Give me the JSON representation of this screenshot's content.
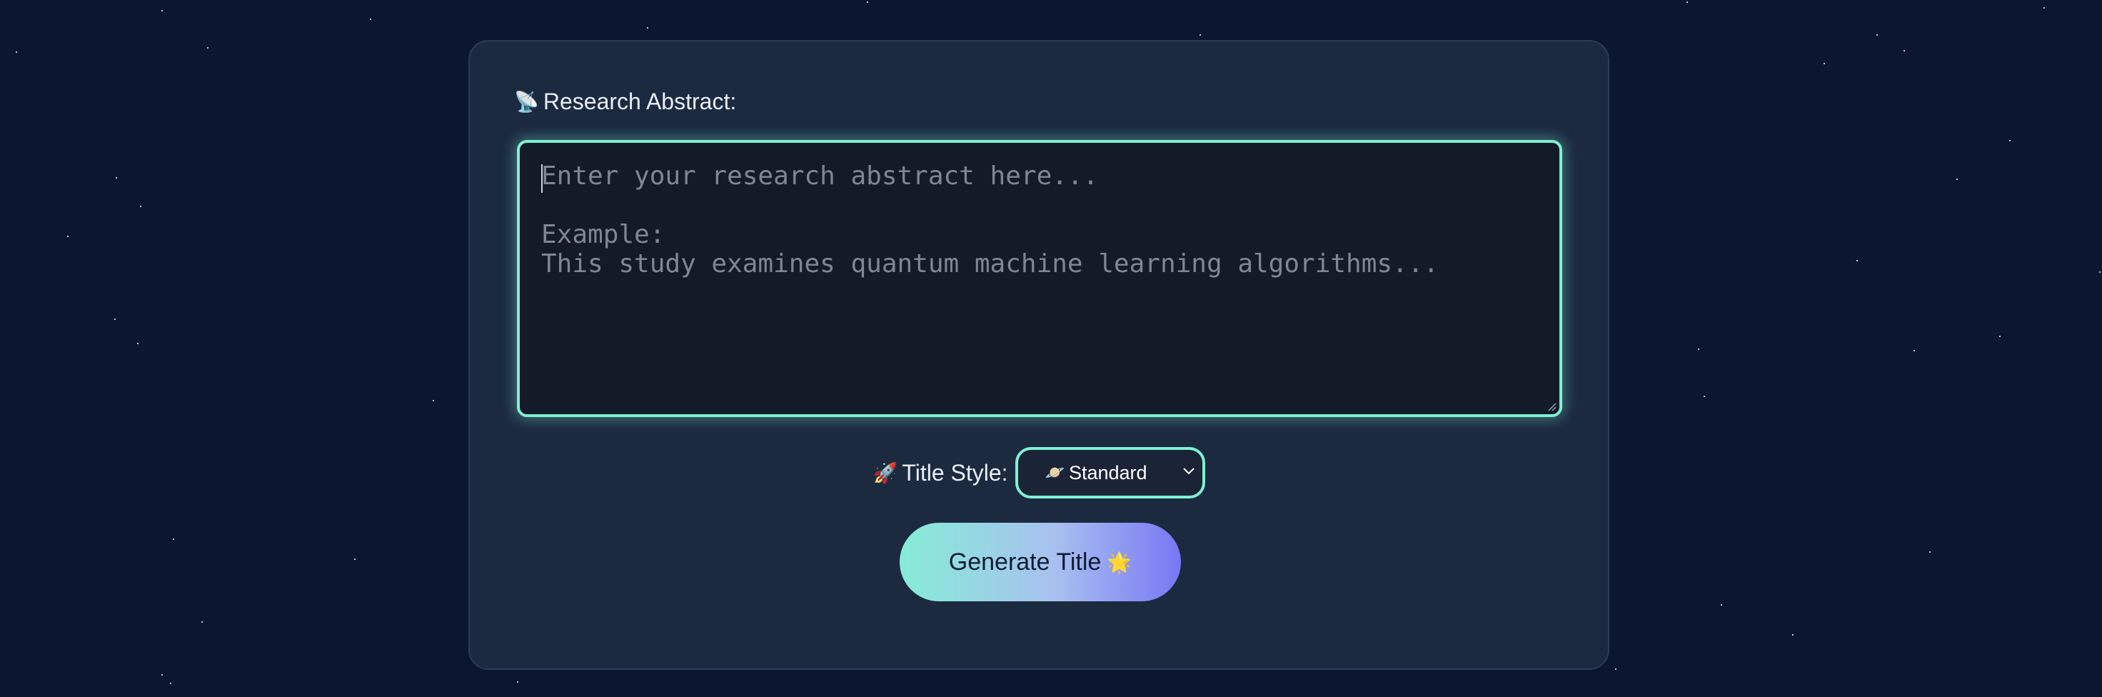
{
  "abstract_field": {
    "label": "Research Abstract:",
    "label_icon": "satellite-antenna-icon",
    "placeholder": "Enter your research abstract here...\n\nExample:\nThis study examines quantum machine learning algorithms...",
    "value": ""
  },
  "title_style": {
    "label": "Title Style:",
    "label_icon": "rocket-icon",
    "selected_value": "Standard",
    "selected_icon": "ringed-planet-icon"
  },
  "generate_button": {
    "label": "Generate Title",
    "icon": "glowing-star-icon"
  },
  "colors": {
    "background": "#0b1730",
    "card": "#1c2a40",
    "accent": "#7ff0d2",
    "button_gradient_start": "#86ecd6",
    "button_gradient_end": "#7877f4"
  }
}
